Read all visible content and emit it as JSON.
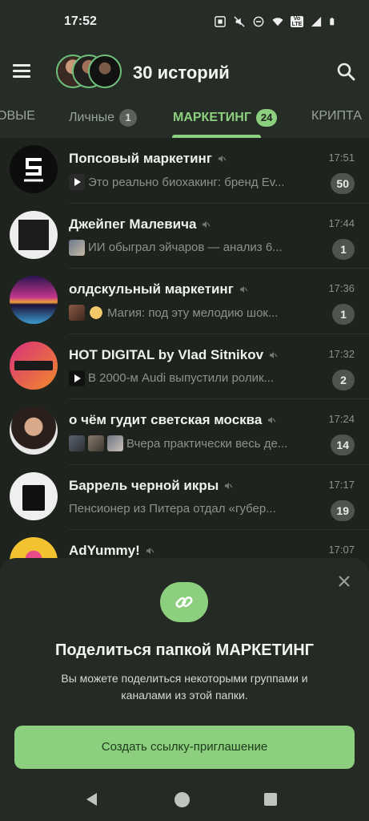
{
  "status_bar": {
    "time": "17:52",
    "lte_label": "Vo LTE"
  },
  "app_bar": {
    "title": "30 историй"
  },
  "tabs": [
    {
      "label": "ОВЫЕ",
      "count": ""
    },
    {
      "label": "Личные",
      "count": "1"
    },
    {
      "label": "МАРКЕТИНГ",
      "count": "24"
    },
    {
      "label": "КРИПТА",
      "count": ""
    }
  ],
  "chats": [
    {
      "name": "Попсовый маркетинг",
      "time": "17:51",
      "preview": "Это реально биохакинг: бренд Ev...",
      "unread": "50"
    },
    {
      "name": "Джейпег Малевича",
      "time": "17:44",
      "preview": "ИИ обыграл эйчаров — анализ 6...",
      "unread": "1"
    },
    {
      "name": "олдскульный маркетинг",
      "time": "17:36",
      "preview": "Магия: под эту мелодию шок...",
      "unread": "1"
    },
    {
      "name": "HOT DIGITAL by Vlad Sitnikov",
      "time": "17:32",
      "preview": "В 2000-м Audi выпустили ролик...",
      "unread": "2"
    },
    {
      "name": "о чём гудит светская москва",
      "time": "17:24",
      "preview": "Вчера практически весь де...",
      "unread": "14"
    },
    {
      "name": "Баррель черной икры",
      "time": "17:17",
      "preview": "Пенсионер из Питера отдал «губер...",
      "unread": "19"
    },
    {
      "name": "AdYummy!",
      "time": "17:07",
      "preview": "",
      "unread": ""
    }
  ],
  "sheet": {
    "title": "Поделиться папкой МАРКЕТИНГ",
    "description": "Вы можете поделиться некоторыми группами и каналами из этой папки.",
    "button_label": "Создать ссылку-приглашение"
  },
  "colors": {
    "accent": "#8ccf7e",
    "background": "#1e231e",
    "surface": "#262c26"
  }
}
